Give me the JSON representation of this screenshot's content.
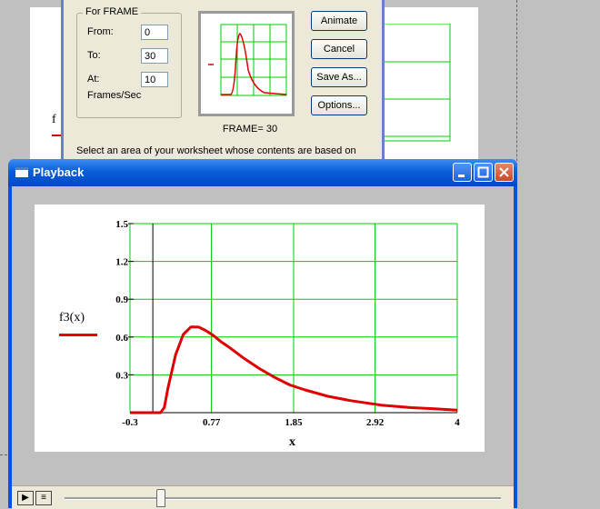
{
  "background_sheet": {
    "function_label": "f"
  },
  "animate_dialog": {
    "group_title": "For FRAME",
    "from_label": "From:",
    "from_value": "0",
    "to_label": "To:",
    "to_value": "30",
    "at_label": "At:",
    "at_value": "10",
    "rate_label": "Frames/Sec",
    "frame_label": "FRAME=  30",
    "buttons": {
      "animate": "Animate",
      "cancel": "Cancel",
      "save_as": "Save As...",
      "options": "Options..."
    },
    "description": "Select an area of your worksheet whose contents are based on"
  },
  "playback": {
    "title": "Playback",
    "play_symbol": "▶",
    "menu_symbol": "≡",
    "slider_position": 0.22
  },
  "chart_data": {
    "type": "line",
    "title": "",
    "series": [
      {
        "name": "f3(x)",
        "color": "#e00000",
        "x": [
          -0.3,
          0.0,
          0.1,
          0.15,
          0.2,
          0.3,
          0.4,
          0.5,
          0.6,
          0.7,
          0.8,
          0.9,
          1.0,
          1.2,
          1.4,
          1.6,
          1.8,
          2.0,
          2.3,
          2.6,
          3.0,
          3.4,
          3.7,
          4.0
        ],
        "y": [
          0,
          0,
          0,
          0.04,
          0.2,
          0.46,
          0.62,
          0.68,
          0.68,
          0.65,
          0.61,
          0.56,
          0.52,
          0.43,
          0.35,
          0.28,
          0.22,
          0.18,
          0.13,
          0.095,
          0.06,
          0.04,
          0.03,
          0.02
        ]
      }
    ],
    "xlabel": "x",
    "ylabel": "f3(x)",
    "xlim": [
      -0.3,
      4
    ],
    "ylim": [
      0,
      1.5
    ],
    "x_ticks": [
      "-0.3",
      "0.77",
      "1.85",
      "2.92",
      "4"
    ],
    "y_ticks": [
      "1.5",
      "1.2",
      "0.9",
      "0.6",
      "0.3"
    ],
    "y_tick_values": [
      1.5,
      1.2,
      0.9,
      0.6,
      0.3
    ],
    "grid": true,
    "grid_color": "#00cc00",
    "legend": "left"
  }
}
